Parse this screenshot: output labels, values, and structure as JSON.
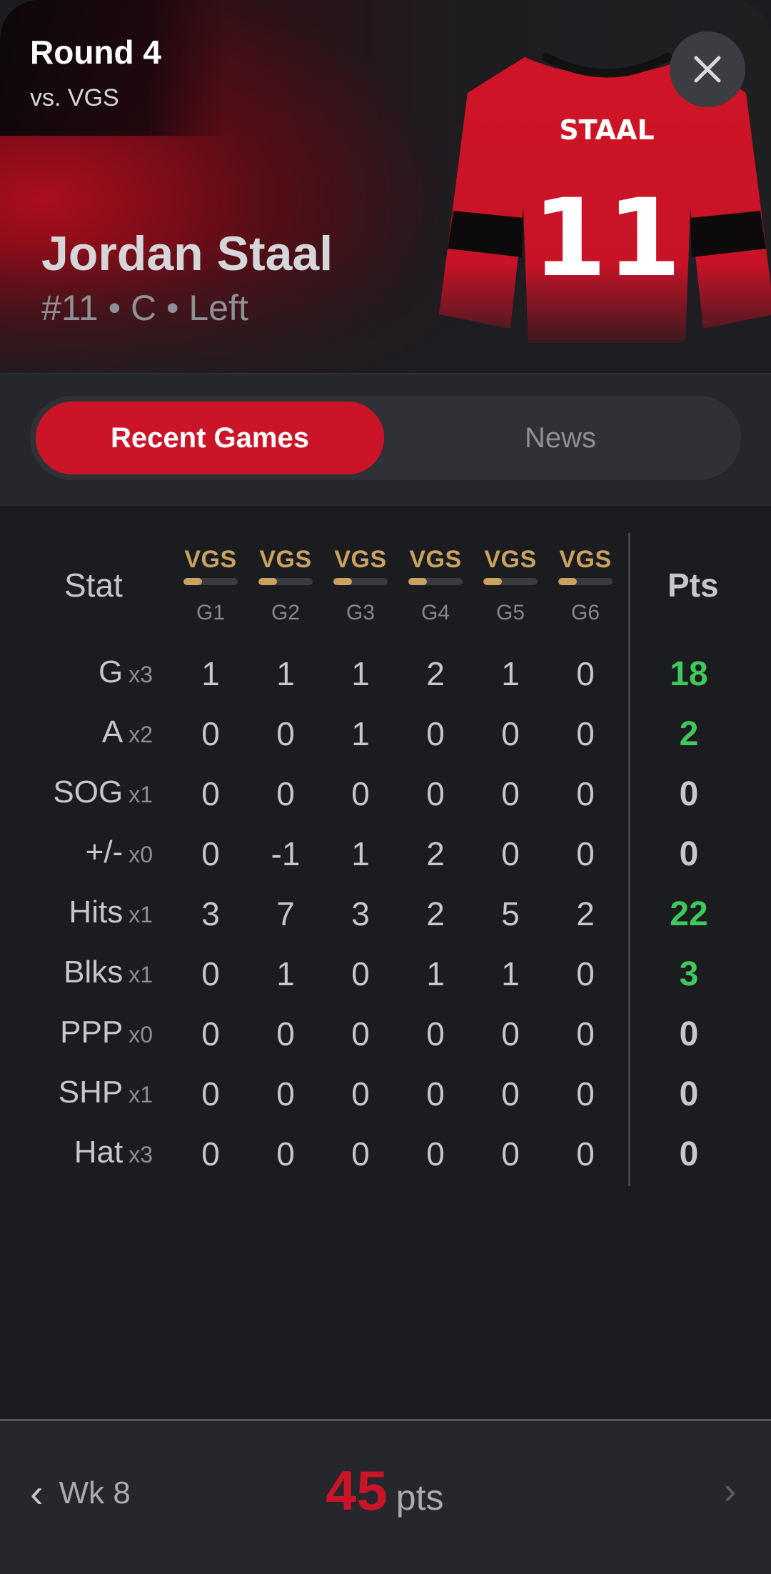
{
  "header": {
    "round": "Round 4",
    "opponent": "vs. VGS",
    "player_name": "Jordan Staal",
    "player_meta": "#11 • C • Left",
    "jersey_name": "STAAL",
    "jersey_number": "11"
  },
  "tabs": {
    "active": "Recent Games",
    "other": "News"
  },
  "table": {
    "stat_header": "Stat",
    "pts_header": "Pts",
    "games": [
      {
        "opp": "VGS",
        "label": "G1"
      },
      {
        "opp": "VGS",
        "label": "G2"
      },
      {
        "opp": "VGS",
        "label": "G3"
      },
      {
        "opp": "VGS",
        "label": "G4"
      },
      {
        "opp": "VGS",
        "label": "G5"
      },
      {
        "opp": "VGS",
        "label": "G6"
      }
    ],
    "rows": [
      {
        "stat": "G",
        "mult": "x3",
        "values": [
          "1",
          "1",
          "1",
          "2",
          "1",
          "0"
        ],
        "pts": "18",
        "highlight": true
      },
      {
        "stat": "A",
        "mult": "x2",
        "values": [
          "0",
          "0",
          "1",
          "0",
          "0",
          "0"
        ],
        "pts": "2",
        "highlight": true
      },
      {
        "stat": "SOG",
        "mult": "x1",
        "values": [
          "0",
          "0",
          "0",
          "0",
          "0",
          "0"
        ],
        "pts": "0",
        "highlight": false
      },
      {
        "stat": "+/-",
        "mult": "x0",
        "values": [
          "0",
          "-1",
          "1",
          "2",
          "0",
          "0"
        ],
        "pts": "0",
        "highlight": false
      },
      {
        "stat": "Hits",
        "mult": "x1",
        "values": [
          "3",
          "7",
          "3",
          "2",
          "5",
          "2"
        ],
        "pts": "22",
        "highlight": true
      },
      {
        "stat": "Blks",
        "mult": "x1",
        "values": [
          "0",
          "1",
          "0",
          "1",
          "1",
          "0"
        ],
        "pts": "3",
        "highlight": true
      },
      {
        "stat": "PPP",
        "mult": "x0",
        "values": [
          "0",
          "0",
          "0",
          "0",
          "0",
          "0"
        ],
        "pts": "0",
        "highlight": false
      },
      {
        "stat": "SHP",
        "mult": "x1",
        "values": [
          "0",
          "0",
          "0",
          "0",
          "0",
          "0"
        ],
        "pts": "0",
        "highlight": false
      },
      {
        "stat": "Hat",
        "mult": "x3",
        "values": [
          "0",
          "0",
          "0",
          "0",
          "0",
          "0"
        ],
        "pts": "0",
        "highlight": false
      }
    ]
  },
  "footer": {
    "prev_label": "Wk 8",
    "prev_icon": "chevron-left-icon",
    "next_icon": "chevron-right-icon",
    "total_points": "45",
    "points_unit": "pts"
  },
  "colors": {
    "accent_red": "#cc1428",
    "positive_green": "#3ec95a",
    "opponent_gold": "#c9a25f"
  }
}
